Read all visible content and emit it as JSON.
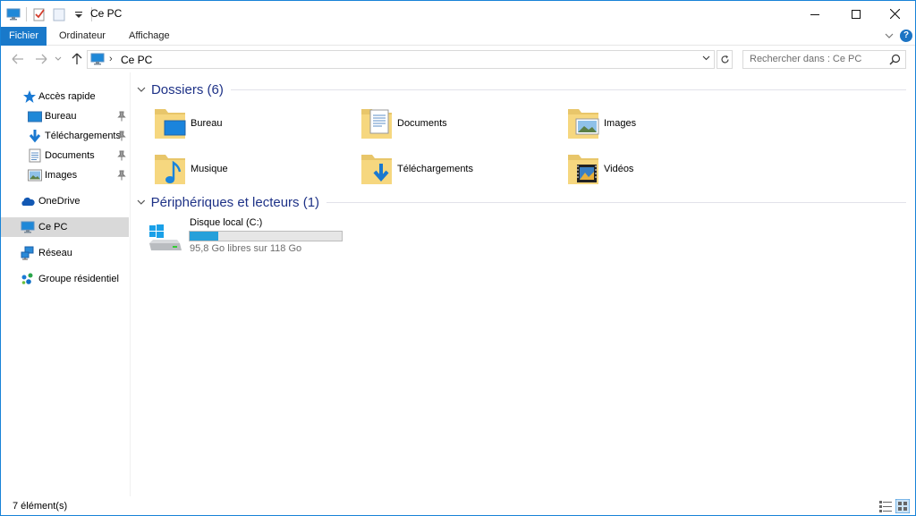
{
  "window": {
    "title": "Ce PC",
    "accent": "#1979ca"
  },
  "quick_access_toolbar": {
    "icons": [
      "this-pc-icon",
      "properties-icon",
      "new-folder-icon",
      "customize-dropdown-icon"
    ]
  },
  "window_controls": {
    "minimize": "minimize-icon",
    "maximize": "maximize-icon",
    "close": "close-icon"
  },
  "ribbon": {
    "tabs": [
      {
        "label": "Fichier",
        "active": true
      },
      {
        "label": "Ordinateur"
      },
      {
        "label": "Affichage"
      }
    ],
    "help_label": "?"
  },
  "address_bar": {
    "crumbs": [
      "Ce PC"
    ],
    "crumb_separator": "›"
  },
  "search": {
    "placeholder": "Rechercher dans : Ce PC"
  },
  "nav_pane": {
    "quick_access": {
      "label": "Accès rapide"
    },
    "pinned": [
      {
        "label": "Bureau",
        "icon": "desktop-icon"
      },
      {
        "label": "Téléchargements",
        "icon": "downloads-icon"
      },
      {
        "label": "Documents",
        "icon": "documents-icon"
      },
      {
        "label": "Images",
        "icon": "pictures-icon"
      }
    ],
    "onedrive": {
      "label": "OneDrive"
    },
    "this_pc": {
      "label": "Ce PC",
      "selected": true
    },
    "network": {
      "label": "Réseau"
    },
    "homegroup": {
      "label": "Groupe résidentiel"
    }
  },
  "content": {
    "folders_group": {
      "title": "Dossiers (6)",
      "items": [
        {
          "label": "Bureau",
          "icon": "desktop-folder-icon"
        },
        {
          "label": "Documents",
          "icon": "documents-folder-icon"
        },
        {
          "label": "Images",
          "icon": "pictures-folder-icon"
        },
        {
          "label": "Musique",
          "icon": "music-folder-icon"
        },
        {
          "label": "Téléchargements",
          "icon": "downloads-folder-icon"
        },
        {
          "label": "Vidéos",
          "icon": "videos-folder-icon"
        }
      ]
    },
    "drives_group": {
      "title": "Périphériques et lecteurs (1)",
      "drives": [
        {
          "label": "Disque local (C:)",
          "free_text": "95,8 Go libres sur 118 Go",
          "used_fraction": 0.188,
          "bar_color": "#26a0da"
        }
      ]
    }
  },
  "status_bar": {
    "item_count": "7 élément(s)"
  }
}
